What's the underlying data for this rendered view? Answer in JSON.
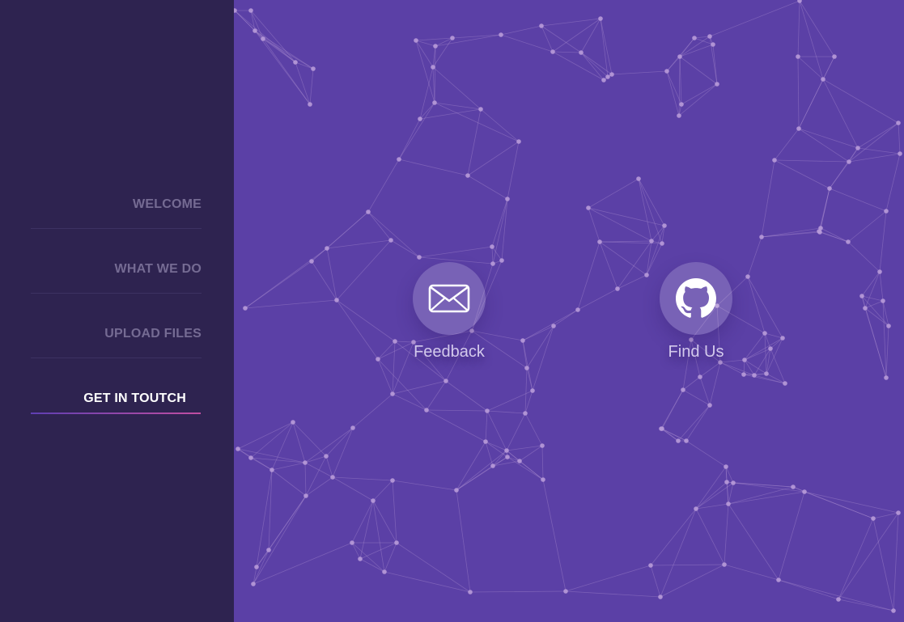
{
  "sidebar": {
    "items": [
      {
        "label": "WELCOME",
        "active": false
      },
      {
        "label": "WHAT WE DO",
        "active": false
      },
      {
        "label": "UPLOAD FILES",
        "active": false
      },
      {
        "label": "GET IN TOUTCH",
        "active": true
      }
    ]
  },
  "contact": {
    "feedback": {
      "label": "Feedback",
      "icon": "envelope-icon"
    },
    "find_us": {
      "label": "Find Us",
      "icon": "github-icon"
    }
  },
  "colors": {
    "background": "#5b40a6",
    "sidebar": "#2e2350",
    "nav_text": "#756b93",
    "nav_active_text": "#ffffff",
    "nav_underline_start": "#5f3fb2",
    "nav_underline_end": "#c14ea2",
    "network_node": "#b79ad8"
  }
}
